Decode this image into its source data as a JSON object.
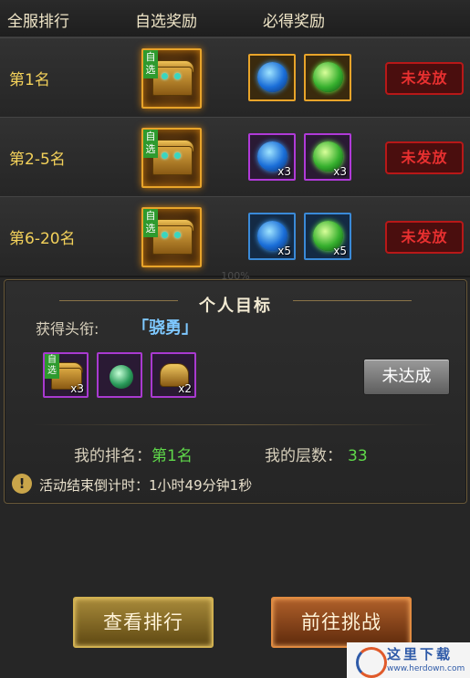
{
  "header": {
    "col_rank": "全服排行",
    "col_optional": "自选奖励",
    "col_guaranteed": "必得奖励"
  },
  "rows": [
    {
      "rank": "第1名",
      "chest_tag": "自选",
      "items": [
        {
          "icon": "blue-orb-icon",
          "count": ""
        },
        {
          "icon": "green-orb-icon",
          "count": ""
        }
      ],
      "status": "未发放",
      "frame_color": "#e8a42a"
    },
    {
      "rank": "第2-5名",
      "chest_tag": "自选",
      "items": [
        {
          "icon": "blue-orb-icon",
          "count": "x3"
        },
        {
          "icon": "green-orb-icon",
          "count": "x3"
        }
      ],
      "status": "未发放",
      "frame_color": "#b03ad8"
    },
    {
      "rank": "第6-20名",
      "chest_tag": "自选",
      "items": [
        {
          "icon": "blue-orb-icon",
          "count": "x5"
        },
        {
          "icon": "green-orb-icon",
          "count": "x5"
        }
      ],
      "status": "未发放",
      "frame_color": "#3a8ad8"
    }
  ],
  "ghost_text": "100%",
  "personal": {
    "title": "个人目标",
    "title_label": "获得头衔:",
    "title_value": "「骁勇」",
    "rewards": [
      {
        "icon": "chest-icon",
        "tag": "自选",
        "count": "x3"
      },
      {
        "icon": "jade-orb-icon",
        "count": ""
      },
      {
        "icon": "gold-armor-icon",
        "count": "x2"
      }
    ],
    "status_button": "未达成",
    "my_rank_label": "我的排名：",
    "my_rank_value": "第1名",
    "my_floor_label": "我的层数：",
    "my_floor_value": "33",
    "countdown_label": "活动结束倒计时：",
    "countdown_value": "1小时49分钟1秒",
    "warn_glyph": "!"
  },
  "buttons": {
    "view_ranking": "查看排行",
    "go_challenge": "前往挑战"
  },
  "watermark": {
    "text": "这里下载",
    "url": "www.herdown.com"
  }
}
